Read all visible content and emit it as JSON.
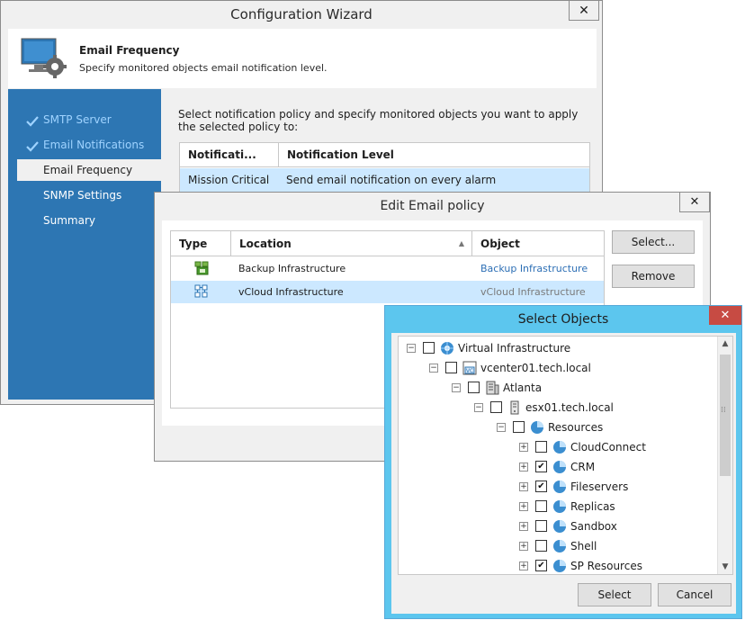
{
  "wizard": {
    "title": "Configuration Wizard",
    "close": "✕",
    "header_title": "Email Frequency",
    "header_subtitle": "Specify monitored objects email notification level.",
    "steps": [
      {
        "label": "SMTP Server",
        "state": "done"
      },
      {
        "label": "Email Notifications",
        "state": "done"
      },
      {
        "label": "Email Frequency",
        "state": "active"
      },
      {
        "label": "SNMP Settings",
        "state": "pending"
      },
      {
        "label": "Summary",
        "state": "pending"
      }
    ],
    "intro": "Select notification policy and specify monitored objects you want to apply the selected policy to:",
    "policy_table": {
      "columns": [
        "Notificati...",
        "Notification Level"
      ],
      "rows": [
        [
          "Mission Critical",
          "Send email notification on every alarm"
        ]
      ]
    }
  },
  "edit_policy": {
    "title": "Edit Email policy",
    "close": "✕",
    "columns": {
      "type": "Type",
      "location": "Location",
      "object": "Object"
    },
    "rows": [
      {
        "icon": "backup-infrastructure-icon",
        "location": "Backup Infrastructure",
        "object": "Backup Infrastructure"
      },
      {
        "icon": "vcloud-infrastructure-icon",
        "location": "vCloud Infrastructure",
        "object": "vCloud Infrastructure"
      }
    ],
    "buttons": {
      "select": "Select...",
      "remove": "Remove"
    }
  },
  "select_objects": {
    "title": "Select Objects",
    "close": "✕",
    "tree": [
      {
        "label": "Virtual Infrastructure",
        "level": 0,
        "expander": "⊟",
        "checked": false,
        "icon": "virtual-infrastructure-icon"
      },
      {
        "label": "vcenter01.tech.local",
        "level": 1,
        "expander": "⊟",
        "checked": false,
        "icon": "vcenter-icon"
      },
      {
        "label": "Atlanta",
        "level": 2,
        "expander": "⊟",
        "checked": false,
        "icon": "datacenter-icon"
      },
      {
        "label": "esx01.tech.local",
        "level": 3,
        "expander": "⊟",
        "checked": false,
        "icon": "host-icon"
      },
      {
        "label": "Resources",
        "level": 4,
        "expander": "⊟",
        "checked": false,
        "icon": "resource-pool-icon"
      },
      {
        "label": "CloudConnect",
        "level": 5,
        "expander": "⊞",
        "checked": false,
        "icon": "resource-pool-icon"
      },
      {
        "label": "CRM",
        "level": 5,
        "expander": "⊞",
        "checked": true,
        "icon": "resource-pool-icon"
      },
      {
        "label": "Fileservers",
        "level": 5,
        "expander": "⊞",
        "checked": true,
        "icon": "resource-pool-icon"
      },
      {
        "label": "Replicas",
        "level": 5,
        "expander": "⊞",
        "checked": false,
        "icon": "resource-pool-icon"
      },
      {
        "label": "Sandbox",
        "level": 5,
        "expander": "⊞",
        "checked": false,
        "icon": "resource-pool-icon"
      },
      {
        "label": "Shell",
        "level": 5,
        "expander": "⊞",
        "checked": false,
        "icon": "resource-pool-icon"
      },
      {
        "label": "SP Resources",
        "level": 5,
        "expander": "⊞",
        "checked": true,
        "icon": "resource-pool-icon"
      }
    ],
    "buttons": {
      "select": "Select",
      "cancel": "Cancel"
    }
  },
  "colors": {
    "accent": "#2d76b3",
    "selection": "#cce8ff",
    "link": "#2d6fb5",
    "dialog_frame": "#5cc6ee",
    "close_red": "#c74b43"
  }
}
